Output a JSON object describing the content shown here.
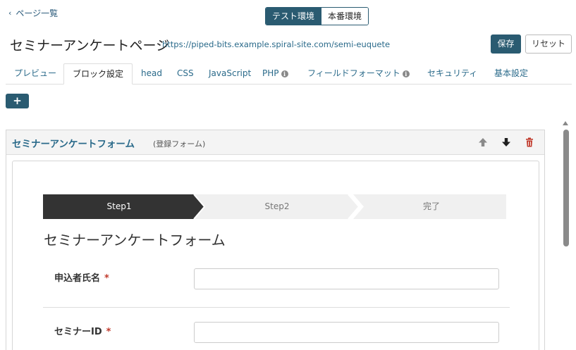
{
  "nav": {
    "back_label": "ページ一覧",
    "back_icon": "chevron-left-icon"
  },
  "env": {
    "test": "テスト環境",
    "prod": "本番環境",
    "active": "test"
  },
  "page": {
    "title": "セミナーアンケートページ",
    "url": "https://piped-bits.example.spiral-site.com/semi-euquete"
  },
  "actions": {
    "save": "保存",
    "reset": "リセット"
  },
  "tabs": [
    {
      "label": "プレビュー"
    },
    {
      "label": "ブロック設定"
    },
    {
      "label": "head"
    },
    {
      "label": "CSS"
    },
    {
      "label": "JavaScript"
    },
    {
      "label": "PHP"
    },
    {
      "label": "フィールドフォーマット"
    },
    {
      "label": "セキュリティ"
    },
    {
      "label": "基本設定"
    }
  ],
  "add_button": "+",
  "block": {
    "title": "セミナーアンケートフォーム",
    "type": "(登録フォーム)",
    "controls": [
      "arrow-up-icon",
      "arrow-down-icon",
      "trash-icon"
    ]
  },
  "form": {
    "steps": [
      {
        "label": "Step1",
        "active": true
      },
      {
        "label": "Step2",
        "active": false
      },
      {
        "label": "完了",
        "active": false
      }
    ],
    "title": "セミナーアンケートフォーム",
    "fields": [
      {
        "label": "申込者氏名",
        "required_mark": "*",
        "value": ""
      },
      {
        "label": "セミナーID",
        "required_mark": "*",
        "value": ""
      }
    ]
  },
  "colors": {
    "primary": "#2a5b71",
    "link": "#2a6a8a",
    "required": "#c0392b",
    "step_active": "#333333",
    "step_inactive": "#f0f0f0",
    "delete": "#c0392b"
  }
}
